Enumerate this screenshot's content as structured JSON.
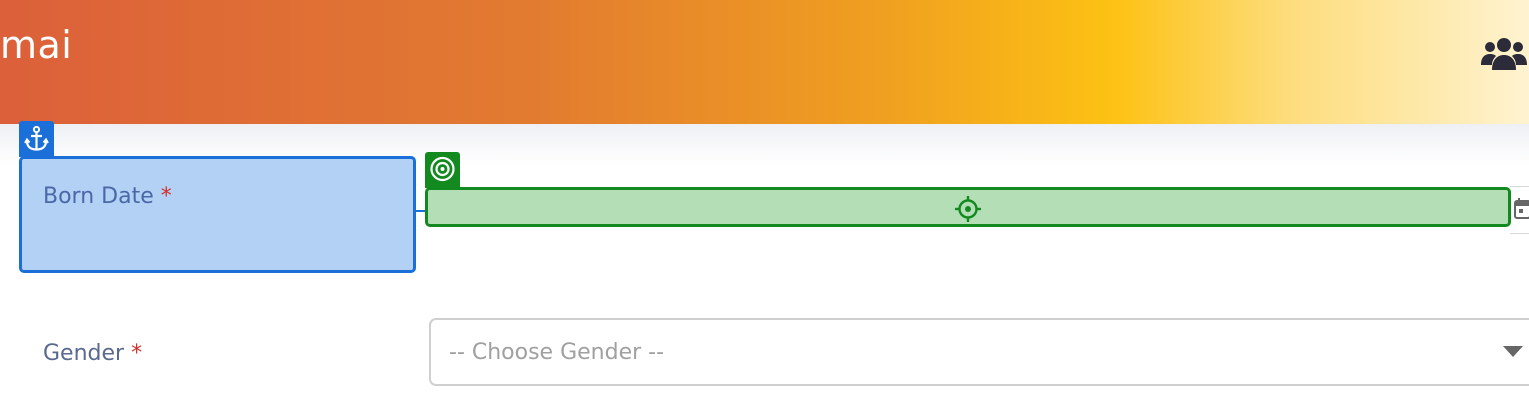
{
  "header": {
    "title": "mai",
    "users_icon": "users-icon"
  },
  "form": {
    "born_date": {
      "label": "Born Date",
      "required_mark": "*",
      "value": "",
      "icon": "calendar-icon"
    },
    "gender": {
      "label": "Gender",
      "required_mark": "*",
      "selected": "-- Choose Gender --",
      "icon": "chevron-down-icon"
    }
  },
  "overlay": {
    "anchor_icon": "anchor-icon",
    "target_icon": "target-icon",
    "crosshair_icon": "crosshair-icon",
    "colors": {
      "anchor": "#1a6fd8",
      "anchor_fill": "#b3d1f5",
      "target": "#138a20",
      "target_fill": "#b3deb6"
    }
  },
  "colors": {
    "header_gradient_start": "#dc603a",
    "header_gradient_mid": "#fdc213",
    "header_gradient_end": "#fff3d0",
    "required": "#d0312d"
  }
}
